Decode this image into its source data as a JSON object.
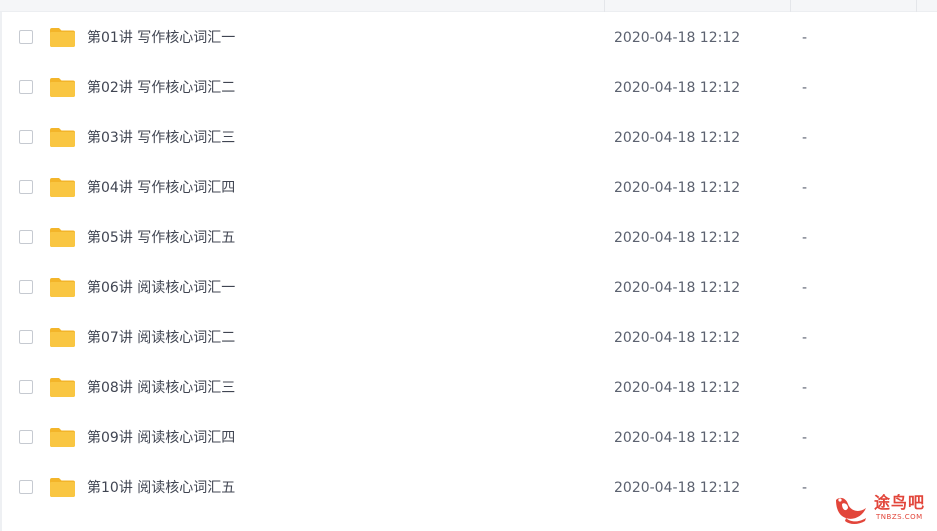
{
  "files": [
    {
      "name": "第01讲 写作核心词汇一",
      "modified": "2020-04-18 12:12",
      "size": "-",
      "icon": "folder-icon"
    },
    {
      "name": "第02讲 写作核心词汇二",
      "modified": "2020-04-18 12:12",
      "size": "-",
      "icon": "folder-icon"
    },
    {
      "name": "第03讲 写作核心词汇三",
      "modified": "2020-04-18 12:12",
      "size": "-",
      "icon": "folder-icon"
    },
    {
      "name": "第04讲 写作核心词汇四",
      "modified": "2020-04-18 12:12",
      "size": "-",
      "icon": "folder-icon"
    },
    {
      "name": "第05讲 写作核心词汇五",
      "modified": "2020-04-18 12:12",
      "size": "-",
      "icon": "folder-icon"
    },
    {
      "name": "第06讲 阅读核心词汇一",
      "modified": "2020-04-18 12:12",
      "size": "-",
      "icon": "folder-icon"
    },
    {
      "name": "第07讲 阅读核心词汇二",
      "modified": "2020-04-18 12:12",
      "size": "-",
      "icon": "folder-icon"
    },
    {
      "name": "第08讲 阅读核心词汇三",
      "modified": "2020-04-18 12:12",
      "size": "-",
      "icon": "folder-icon"
    },
    {
      "name": "第09讲 阅读核心词汇四",
      "modified": "2020-04-18 12:12",
      "size": "-",
      "icon": "folder-icon"
    },
    {
      "name": "第10讲 阅读核心词汇五",
      "modified": "2020-04-18 12:12",
      "size": "-",
      "icon": "folder-icon"
    }
  ],
  "watermark": {
    "text": "途鸟吧",
    "sub": "TNBZS.COM",
    "icon": "bird-logo-icon"
  },
  "colors": {
    "folder": "#f9c642",
    "folder_tab": "#f3b52a",
    "watermark": "#e2453a",
    "name_text": "#404552",
    "meta_text": "#5c6270",
    "checkbox_border": "#c6cad1"
  }
}
